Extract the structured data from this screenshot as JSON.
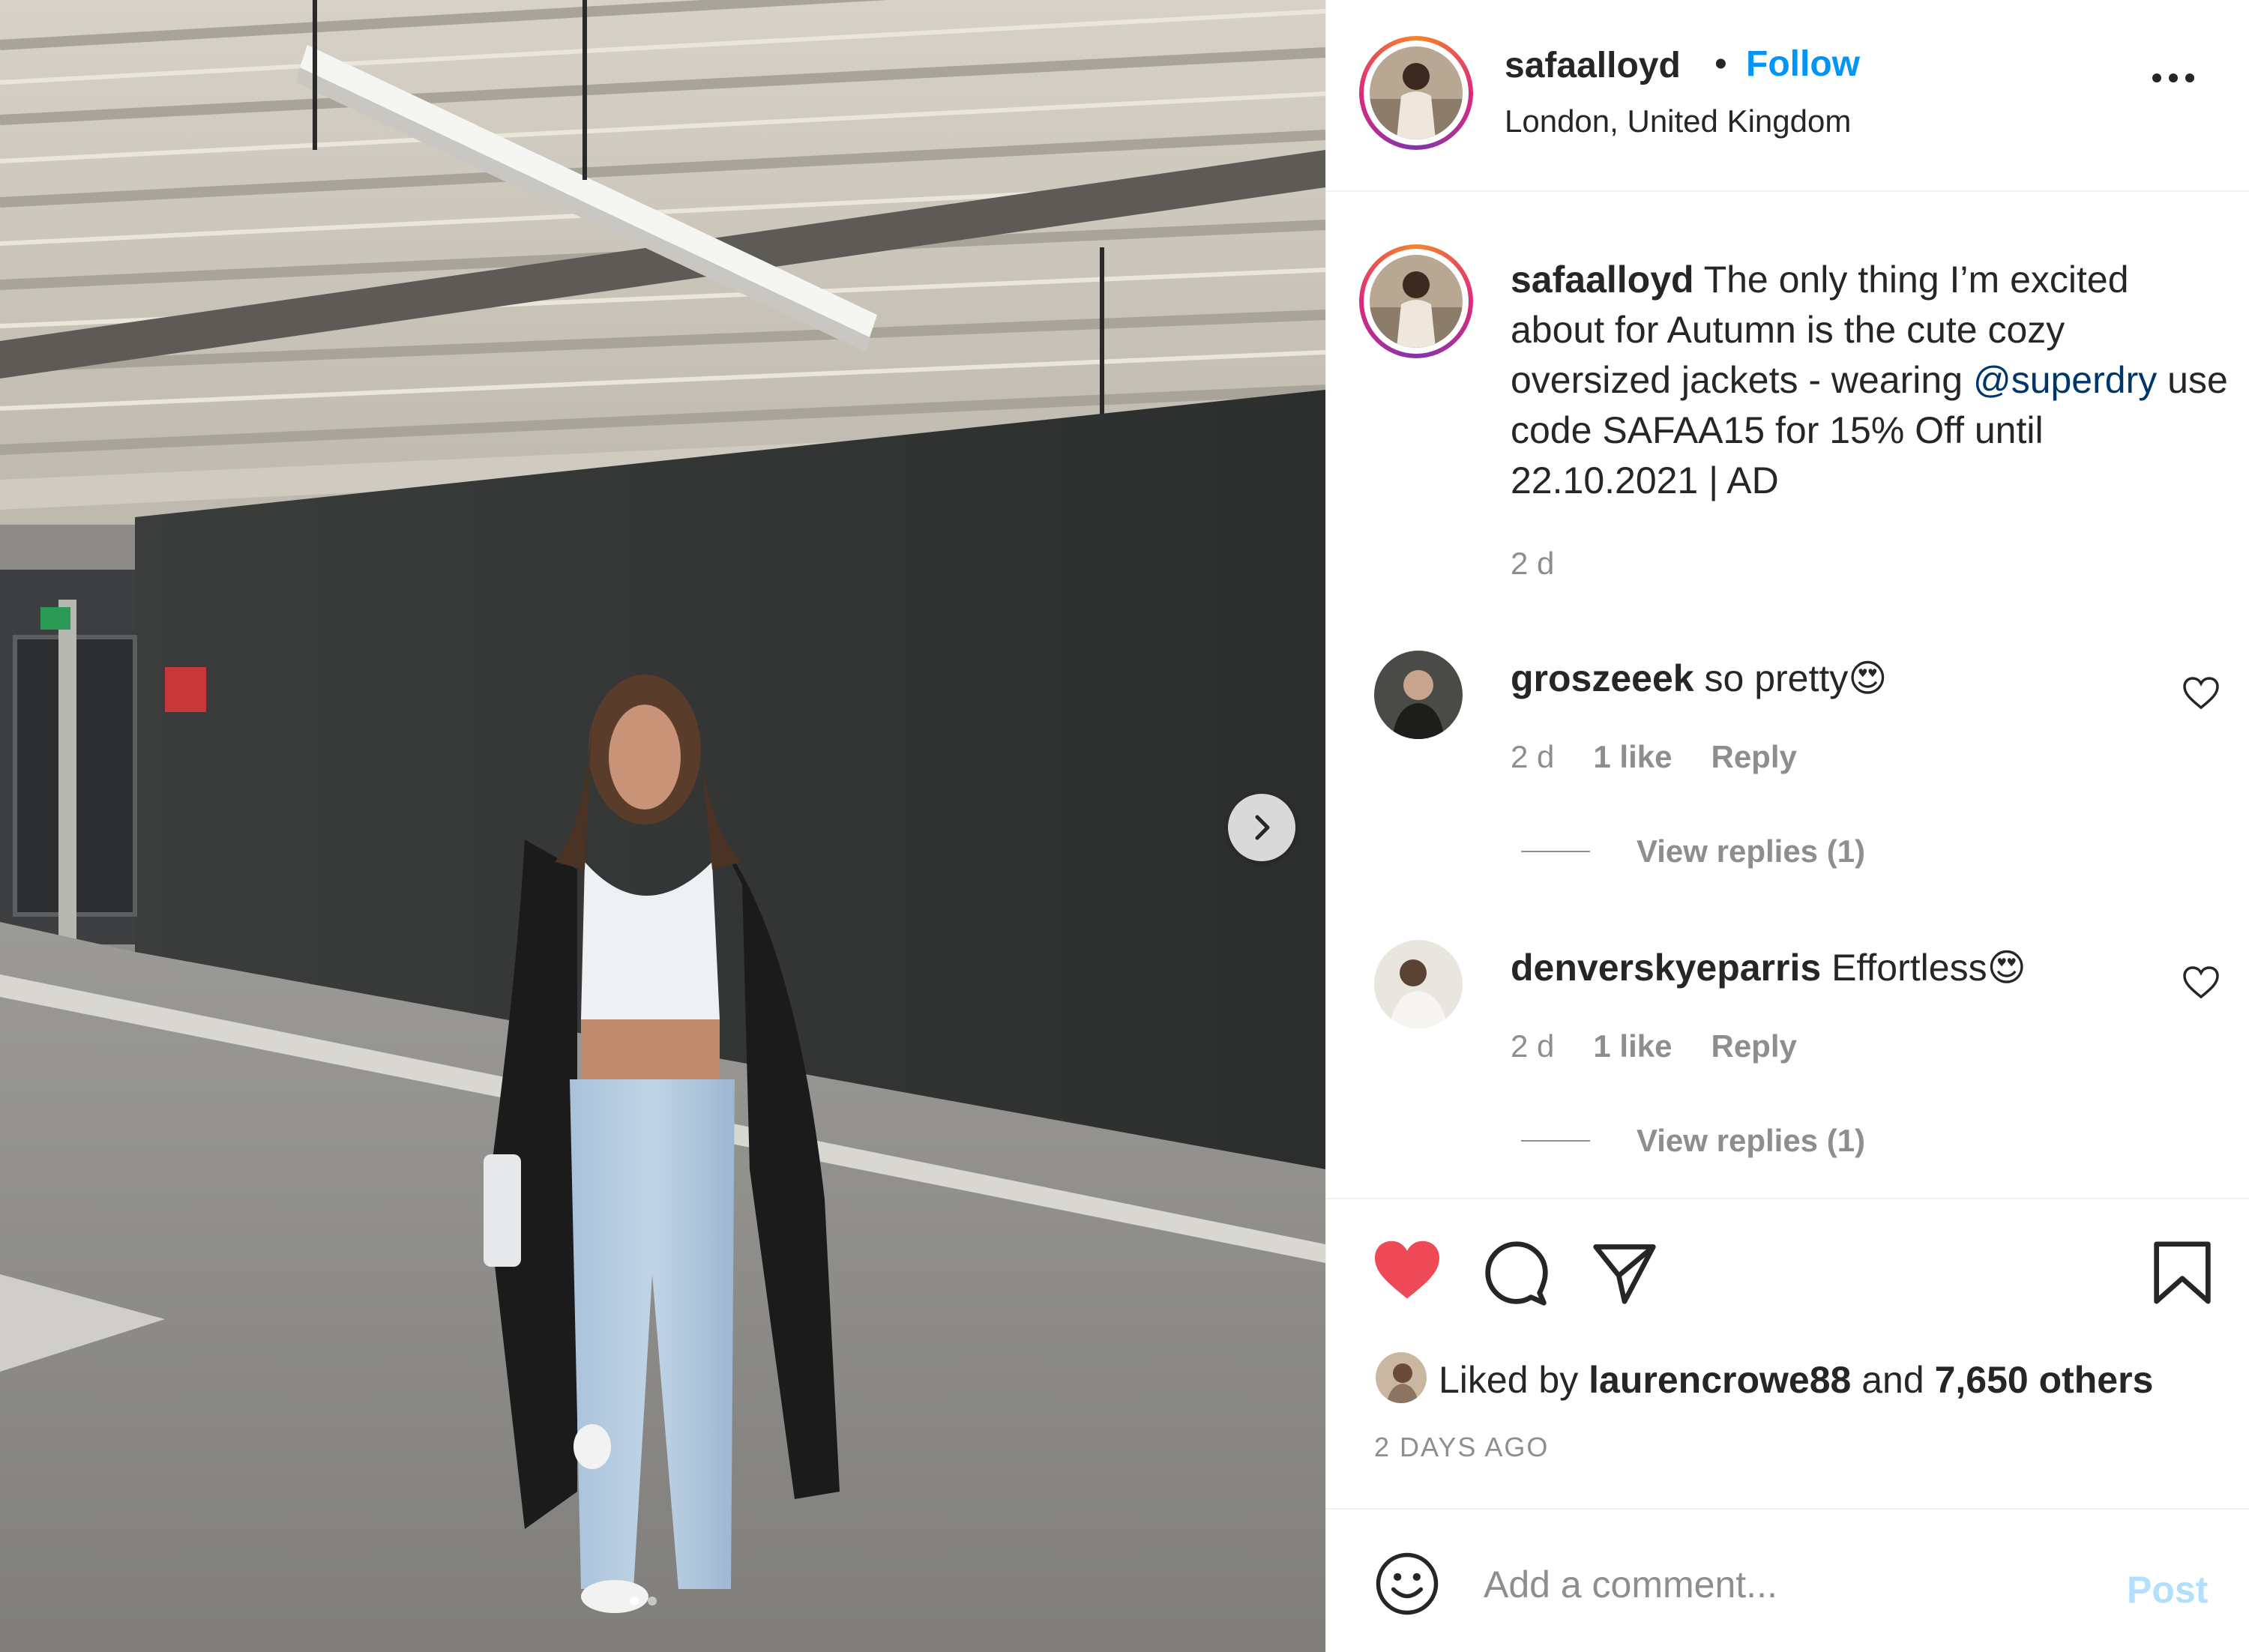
{
  "post": {
    "username": "safaalloyd",
    "separator": "•",
    "follow_label": "Follow",
    "location": "London, United Kingdom",
    "more_icon": "more-options-icon"
  },
  "caption": {
    "username": "safaalloyd",
    "text_before_mention": "The only thing I’m excited about for Autumn is the cute cozy oversized jackets - wearing",
    "mention": "@superdry",
    "text_after_mention": "use code SAFAA15 for 15% Off until 22.10.2021 | AD",
    "time": "2 d"
  },
  "comments": [
    {
      "username": "groszeeek",
      "text": "so pretty😍",
      "time": "2 d",
      "likes": "1 like",
      "reply_label": "Reply",
      "view_replies": "View replies (1)"
    },
    {
      "username": "denverskyeparris",
      "text": "Effortless😍",
      "time": "2 d",
      "likes": "1 like",
      "reply_label": "Reply",
      "view_replies": "View replies (1)"
    }
  ],
  "actions": {
    "like_icon": "heart-filled-icon",
    "comment_icon": "comment-bubble-icon",
    "share_icon": "paper-plane-icon",
    "save_icon": "bookmark-icon",
    "like_color": "#ed4956"
  },
  "likes": {
    "prefix": "Liked by",
    "user": "laurencrowe88",
    "and_label": "and",
    "others": "7,650 others"
  },
  "post_time": "2 DAYS AGO",
  "add_comment": {
    "placeholder": "Add a comment...",
    "post_label": "Post"
  },
  "carousel": {
    "next_icon": "chevron-right-icon",
    "slides": 2,
    "active_slide": 1
  }
}
